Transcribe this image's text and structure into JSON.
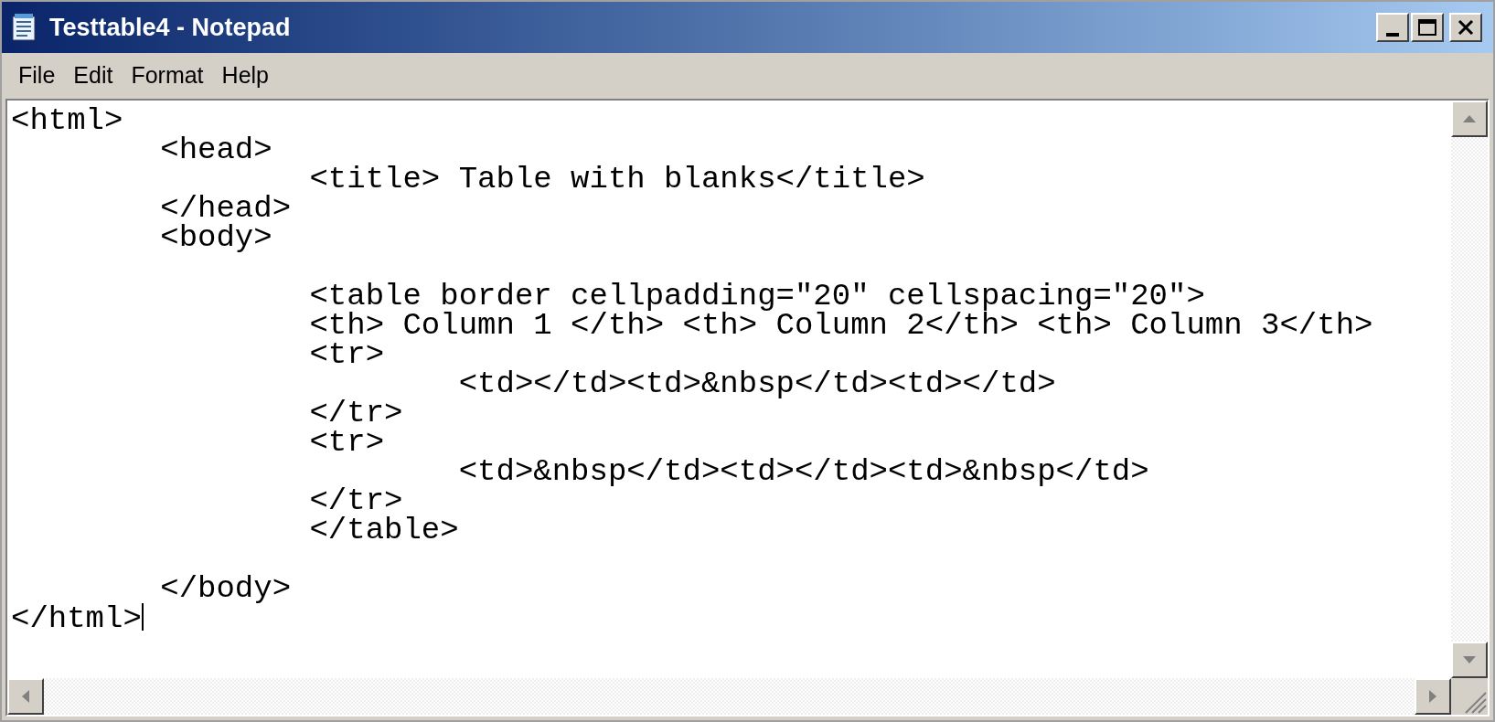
{
  "window": {
    "title": "Testtable4 - Notepad"
  },
  "menu": [
    "File",
    "Edit",
    "Format",
    "Help"
  ],
  "editor": {
    "text": "<html>\n\t<head>\n\t\t<title> Table with blanks</title>\n\t</head>\n\t<body>\n\n\t\t<table border cellpadding=\"20\" cellspacing=\"20\">\n\t\t<th> Column 1 </th> <th> Column 2</th> <th> Column 3</th>\n\t\t<tr>\n\t\t\t<td></td><td>&nbsp</td><td></td>\n\t\t</tr>\n\t\t<tr>\n\t\t\t<td>&nbsp</td><td></td><td>&nbsp</td>\n\t\t</tr>\n\t\t</table>\n\n\t</body>\n</html>",
    "caret": true
  }
}
